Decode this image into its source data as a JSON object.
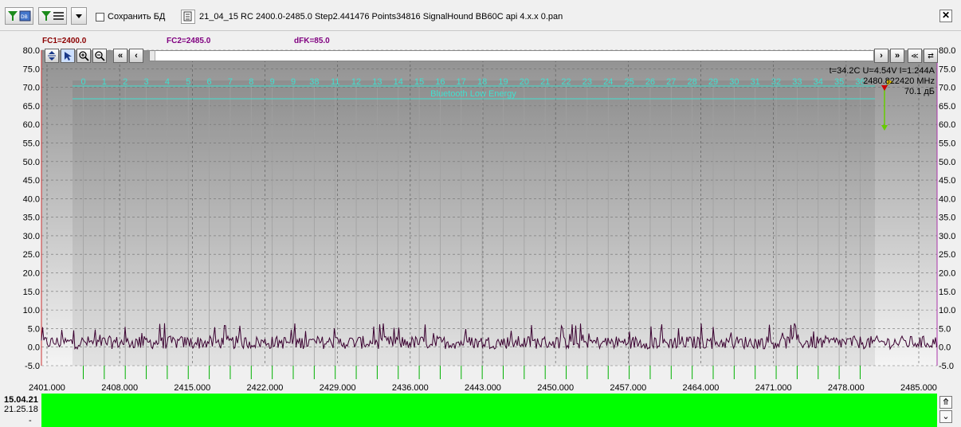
{
  "toolbar": {
    "save_db_label": "Сохранить БД",
    "file_title": "21_04_15 RC 2400.0-2485.0 Step2.441476 Points34816 SignalHound BB60C api 4.x.x 0.pan",
    "close_label": "✕"
  },
  "overlay": {
    "fc1": "FC1=2400.0",
    "fc2": "FC2=2485.0",
    "dfk": "dFK=85.0",
    "band_label": "Bluetooth Low Energy",
    "channels": [
      "0",
      "1",
      "2",
      "3",
      "4",
      "5",
      "6",
      "7",
      "8",
      "9",
      "9",
      "38",
      "11",
      "12",
      "13",
      "14",
      "15",
      "16",
      "17",
      "18",
      "19",
      "20",
      "21",
      "22",
      "23",
      "24",
      "25",
      "26",
      "27",
      "28",
      "29",
      "30",
      "31",
      "32",
      "33",
      "34",
      "35",
      "36"
    ],
    "readout_line1": "t=34.2C U=4.54V I=1.244A",
    "readout_line2": "2480.822420 MHz",
    "readout_line3": "70.1 дБ"
  },
  "controls": {
    "fit_icon": "fit-vertical-icon",
    "marker_icon": "marker-move-icon",
    "zoom_in_icon": "zoom-in-icon",
    "zoom_out_icon": "zoom-out-icon",
    "first_label": "«",
    "prev_label": "‹",
    "next_label": "›",
    "last_label": "»",
    "extra1_label": "≪",
    "extra2_label": "⇄"
  },
  "chart_data": {
    "type": "line",
    "x_ticks": [
      "2401.000",
      "2408.000",
      "2415.000",
      "2422.000",
      "2429.000",
      "2436.000",
      "2443.000",
      "2450.000",
      "2457.000",
      "2464.000",
      "2471.000",
      "2478.000",
      "2485.000"
    ],
    "y_ticks": [
      "80.0",
      "75.0",
      "70.0",
      "65.0",
      "60.0",
      "55.0",
      "50.0",
      "45.0",
      "40.0",
      "35.0",
      "30.0",
      "25.0",
      "20.0",
      "15.0",
      "10.0",
      "5.0",
      "0.0",
      "-5.0"
    ],
    "xlim": [
      2400.0,
      2485.0
    ],
    "ylim": [
      -5.0,
      80.0
    ],
    "grid": true,
    "trace_color": "#3a0030",
    "band_color": "#40e0d0",
    "series": [
      {
        "name": "",
        "level_min": -0.5,
        "level_max": 3.0,
        "spike_max": 6.5
      }
    ]
  },
  "bottom": {
    "date": "15.04.21",
    "time": "21.25.18",
    "dash": "-",
    "waterfall_color": "#00ff00",
    "up_label": "⤊",
    "down_label": "⌄"
  }
}
